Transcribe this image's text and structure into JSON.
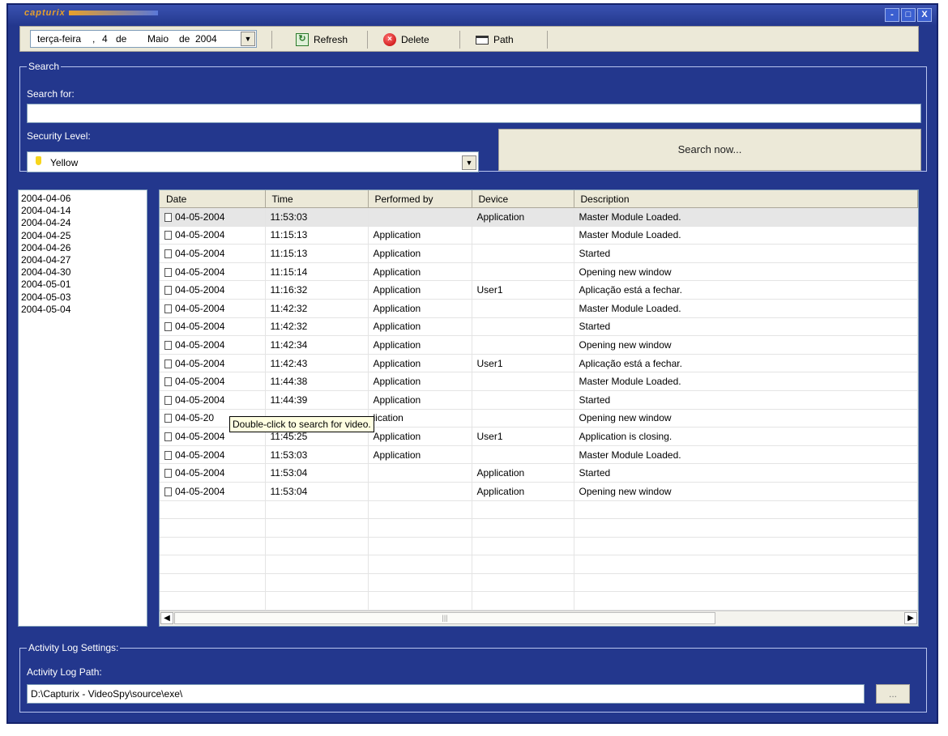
{
  "window": {
    "logo_text": "capturix",
    "controls": {
      "minimize": "-",
      "maximize": "□",
      "close": "X"
    }
  },
  "toolbar": {
    "date": {
      "weekday": "terça-feira",
      "separator": ",",
      "day": "4",
      "de1": "de",
      "month": "Maio",
      "de2": "de",
      "year": "2004"
    },
    "refresh_label": "Refresh",
    "delete_label": "Delete",
    "path_label": "Path"
  },
  "search": {
    "group_title": "Search",
    "search_for_label": "Search for:",
    "search_for_value": "",
    "security_level_label": "Security Level:",
    "security_level_value": "Yellow",
    "search_now_label": "Search now..."
  },
  "dates": [
    "2004-04-06",
    "2004-04-14",
    "2004-04-24",
    "2004-04-25",
    "2004-04-26",
    "2004-04-27",
    "2004-04-30",
    "2004-05-01",
    "2004-05-03",
    "2004-05-04"
  ],
  "log": {
    "columns": [
      "Date",
      "Time",
      "Performed by",
      "Device",
      "Description"
    ],
    "rows": [
      {
        "date": "04-05-2004",
        "time": "11:53:03",
        "by": "",
        "device": "Application",
        "desc": "Master Module Loaded."
      },
      {
        "date": "04-05-2004",
        "time": "11:15:13",
        "by": "Application",
        "device": "",
        "desc": "Master Module Loaded."
      },
      {
        "date": "04-05-2004",
        "time": "11:15:13",
        "by": "Application",
        "device": "",
        "desc": "Started"
      },
      {
        "date": "04-05-2004",
        "time": "11:15:14",
        "by": "Application",
        "device": "",
        "desc": "Opening new window"
      },
      {
        "date": "04-05-2004",
        "time": "11:16:32",
        "by": "Application",
        "device": "User1",
        "desc": "Aplicação está a fechar."
      },
      {
        "date": "04-05-2004",
        "time": "11:42:32",
        "by": "Application",
        "device": "",
        "desc": "Master Module Loaded."
      },
      {
        "date": "04-05-2004",
        "time": "11:42:32",
        "by": "Application",
        "device": "",
        "desc": "Started"
      },
      {
        "date": "04-05-2004",
        "time": "11:42:34",
        "by": "Application",
        "device": "",
        "desc": "Opening new window"
      },
      {
        "date": "04-05-2004",
        "time": "11:42:43",
        "by": "Application",
        "device": "User1",
        "desc": "Aplicação está a fechar."
      },
      {
        "date": "04-05-2004",
        "time": "11:44:38",
        "by": "Application",
        "device": "",
        "desc": "Master Module Loaded."
      },
      {
        "date": "04-05-2004",
        "time": "11:44:39",
        "by": "Application",
        "device": "",
        "desc": "Started"
      },
      {
        "date": "04-05-20",
        "time": "",
        "by": "lication",
        "device": "",
        "desc": "Opening new window"
      },
      {
        "date": "04-05-2004",
        "time": "11:45:25",
        "by": "Application",
        "device": "User1",
        "desc": "Application is closing."
      },
      {
        "date": "04-05-2004",
        "time": "11:53:03",
        "by": "Application",
        "device": "",
        "desc": "Master Module Loaded."
      },
      {
        "date": "04-05-2004",
        "time": "11:53:04",
        "by": "",
        "device": "Application",
        "desc": "Started"
      },
      {
        "date": "04-05-2004",
        "time": "11:53:04",
        "by": "",
        "device": "Application",
        "desc": "Opening new window"
      }
    ],
    "empty_rows": 6,
    "tooltip": "Double-click to search for video."
  },
  "settings": {
    "group_title": "Activity Log Settings:",
    "path_label": "Activity Log Path:",
    "path_value": "D:\\Capturix - VideoSpy\\source\\exe\\",
    "browse_label": "..."
  }
}
